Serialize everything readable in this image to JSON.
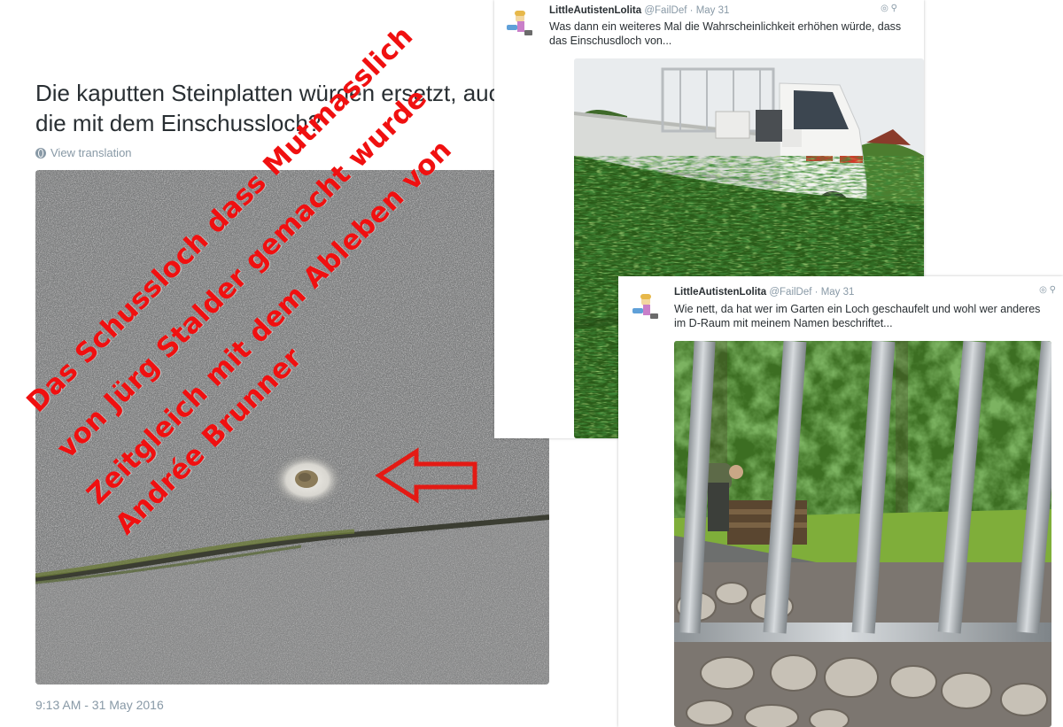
{
  "main_tweet": {
    "text": "Die kaputten Steinplatten würden ersetzt, auch die mit dem Einschussloch?",
    "translate_label": "View translation",
    "timestamp": "9:13 AM - 31 May 2016"
  },
  "annotation": {
    "lines": [
      "Das Schussloch dass Mutmasslich",
      "von Jürg Stalder gemacht wurde",
      "Zeitgleich mit dem Ableben von",
      "Andrée Brunner"
    ],
    "color": "#f01010"
  },
  "replies": [
    {
      "name": "LittleAutistenLolita",
      "handle": "@FailDef",
      "date": "May 31",
      "text": "Was dann ein weiteres Mal die Wahrscheinlichkeit erhöhen würde, dass das Einschusdloch von...",
      "icons": [
        "globe-icon",
        "location-pin-icon"
      ]
    },
    {
      "name": "LittleAutistenLolita",
      "handle": "@FailDef",
      "date": "May 31",
      "text": "Wie nett, da hat wer im Garten ein Loch geschaufelt und wohl wer anderes im D-Raum mit meinem Namen beschriftet...",
      "icons": [
        "globe-icon",
        "location-pin-icon"
      ]
    }
  ],
  "colors": {
    "text": "#292f33",
    "meta": "#8899a6",
    "annotation_red": "#f01010"
  }
}
